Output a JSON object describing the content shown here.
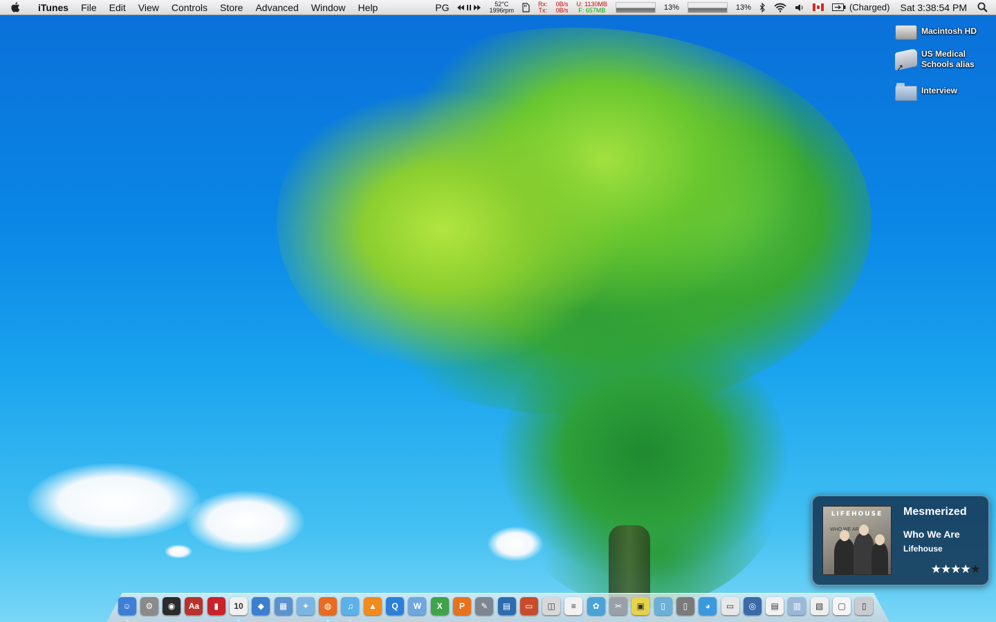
{
  "menubar": {
    "app_name": "iTunes",
    "menus": [
      "File",
      "Edit",
      "View",
      "Controls",
      "Store",
      "Advanced",
      "Window",
      "Help"
    ],
    "status": {
      "pg": "PG",
      "temp": "52°C",
      "fan": "1996rpm",
      "rx_label": "Rx:",
      "tx_label": "Tx:",
      "rx_val": "0B/s",
      "tx_val": "0B/s",
      "mem_used": "U: 1130MB",
      "mem_free": "F:  657MB",
      "cpu1": "13%",
      "cpu2": "13%",
      "battery": "(Charged)",
      "clock": "Sat 3:38:54 PM"
    }
  },
  "desktop_icons": [
    {
      "label": "Macintosh HD",
      "icon": "hard-drive-icon"
    },
    {
      "label": "US Medical Schools alias",
      "icon": "alias-folder-icon"
    },
    {
      "label": "Interview",
      "icon": "folder-icon"
    }
  ],
  "growl": {
    "title": "Mesmerized",
    "album": "Who We Are",
    "artist": "Lifehouse",
    "album_art_band": "LIFEHOUSE",
    "album_art_sub": "WHO WE ARE",
    "rating": 4,
    "rating_max": 5
  },
  "dock": {
    "items": [
      {
        "name": "finder",
        "color": "#3d7fd6",
        "glyph": "☺",
        "running": true
      },
      {
        "name": "system-preferences",
        "color": "#8a8a8a",
        "glyph": "⚙",
        "running": false
      },
      {
        "name": "dashboard",
        "color": "#2b2b2b",
        "glyph": "◉",
        "running": false
      },
      {
        "name": "dictionary",
        "color": "#b8322c",
        "glyph": "Aa",
        "running": false
      },
      {
        "name": "front-row",
        "color": "#c8232a",
        "glyph": "▮",
        "running": false
      },
      {
        "name": "ical",
        "color": "#f0f0f0",
        "glyph": "10",
        "running": true
      },
      {
        "name": "water-drop",
        "color": "#3a7fd0",
        "glyph": "◆",
        "running": false
      },
      {
        "name": "preview",
        "color": "#5a93d0",
        "glyph": "▦",
        "running": false
      },
      {
        "name": "safari",
        "color": "#7bb6e3",
        "glyph": "✦",
        "running": false
      },
      {
        "name": "firefox",
        "color": "#e86b1f",
        "glyph": "◍",
        "running": true
      },
      {
        "name": "itunes",
        "color": "#5cb1e8",
        "glyph": "♫",
        "running": true
      },
      {
        "name": "vlc",
        "color": "#f28a1c",
        "glyph": "▲",
        "running": false
      },
      {
        "name": "quicktime",
        "color": "#2b7fd9",
        "glyph": "Q",
        "running": false
      },
      {
        "name": "word",
        "color": "#6ea6e0",
        "glyph": "W",
        "running": false
      },
      {
        "name": "excel",
        "color": "#3ea34a",
        "glyph": "X",
        "running": false
      },
      {
        "name": "powerpoint",
        "color": "#e8731f",
        "glyph": "P",
        "running": false
      },
      {
        "name": "script-editor",
        "color": "#7d8792",
        "glyph": "✎",
        "running": false
      },
      {
        "name": "grapher",
        "color": "#2c6cb0",
        "glyph": "▤",
        "running": false
      },
      {
        "name": "keynote",
        "color": "#c94c2a",
        "glyph": "▭",
        "running": false
      },
      {
        "name": "photo-booth",
        "color": "#d8d8d8",
        "glyph": "◫",
        "running": false
      },
      {
        "name": "textedit",
        "color": "#f2f2f2",
        "glyph": "≡",
        "running": false
      },
      {
        "name": "cyberduck",
        "color": "#4aa3d8",
        "glyph": "✿",
        "running": false
      },
      {
        "name": "utility-tool",
        "color": "#9aa0a8",
        "glyph": "✂",
        "running": false
      },
      {
        "name": "stuffit",
        "color": "#e6d34a",
        "glyph": "▣",
        "running": false
      },
      {
        "name": "bottle",
        "color": "#6bb0d8",
        "glyph": "▯",
        "running": false
      },
      {
        "name": "trash-can",
        "color": "#7a7a7a",
        "glyph": "▯",
        "running": false
      },
      {
        "name": "globe-app",
        "color": "#3a9ae0",
        "glyph": "◕",
        "running": false
      },
      {
        "name": "printer",
        "color": "#e8e8e8",
        "glyph": "▭",
        "running": false
      },
      {
        "name": "network-stack",
        "color": "#3b6aa8",
        "glyph": "◎",
        "running": false
      },
      {
        "name": "document-stack",
        "color": "#f2f2f2",
        "glyph": "▤",
        "running": false
      },
      {
        "name": "downloads-stack",
        "color": "#9ab8d6",
        "glyph": "▥",
        "running": false
      },
      {
        "name": "pdf-stack",
        "color": "#efefef",
        "glyph": "▧",
        "running": false
      },
      {
        "name": "file-stack",
        "color": "#f5f5f5",
        "glyph": "▢",
        "running": false
      },
      {
        "name": "trash",
        "color": "#c8ccd0",
        "glyph": "▯",
        "running": false
      }
    ]
  }
}
